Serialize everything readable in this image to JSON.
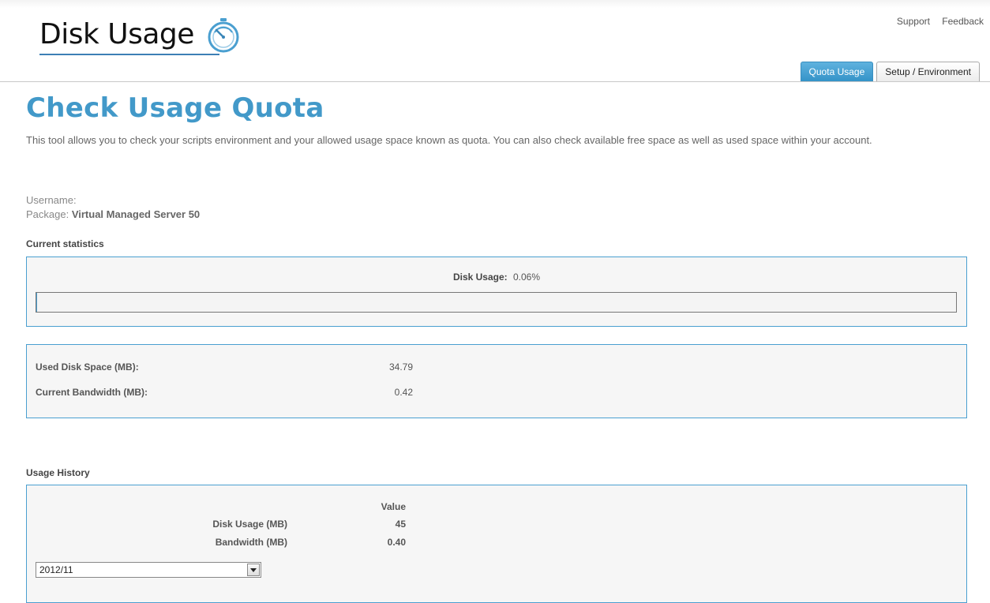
{
  "app": {
    "logo_text": "Disk Usage",
    "logo_icon": "stopwatch-icon"
  },
  "toplinks": {
    "support": "Support",
    "feedback": "Feedback"
  },
  "tabs": [
    {
      "label": "Quota Usage",
      "active": true
    },
    {
      "label": "Setup / Environment",
      "active": false
    }
  ],
  "page": {
    "title": "Check Usage Quota",
    "description": "This tool allows you to check your scripts environment and your allowed usage space known as quota. You can also check available free space as well as used space within your account."
  },
  "account": {
    "username_label": "Username:",
    "username_value": "",
    "package_label": "Package:",
    "package_value": "Virtual Managed Server 50"
  },
  "current_statistics": {
    "section_label": "Current statistics",
    "disk_usage_label": "Disk Usage:",
    "disk_usage_value": "0.06%",
    "disk_usage_fraction": 0.0006,
    "used_disk_label": "Used Disk Space (MB):",
    "used_disk_value": "34.79",
    "bandwidth_label": "Current Bandwidth (MB):",
    "bandwidth_value": "0.42"
  },
  "usage_history": {
    "section_label": "Usage History",
    "value_header": "Value",
    "rows": [
      {
        "label": "Disk Usage (MB)",
        "value": "45"
      },
      {
        "label": "Bandwidth (MB)",
        "value": "0.40"
      }
    ],
    "period_selected": "2012/11"
  },
  "colors": {
    "accent": "#4299c9",
    "box_border": "#4a9fd0"
  }
}
